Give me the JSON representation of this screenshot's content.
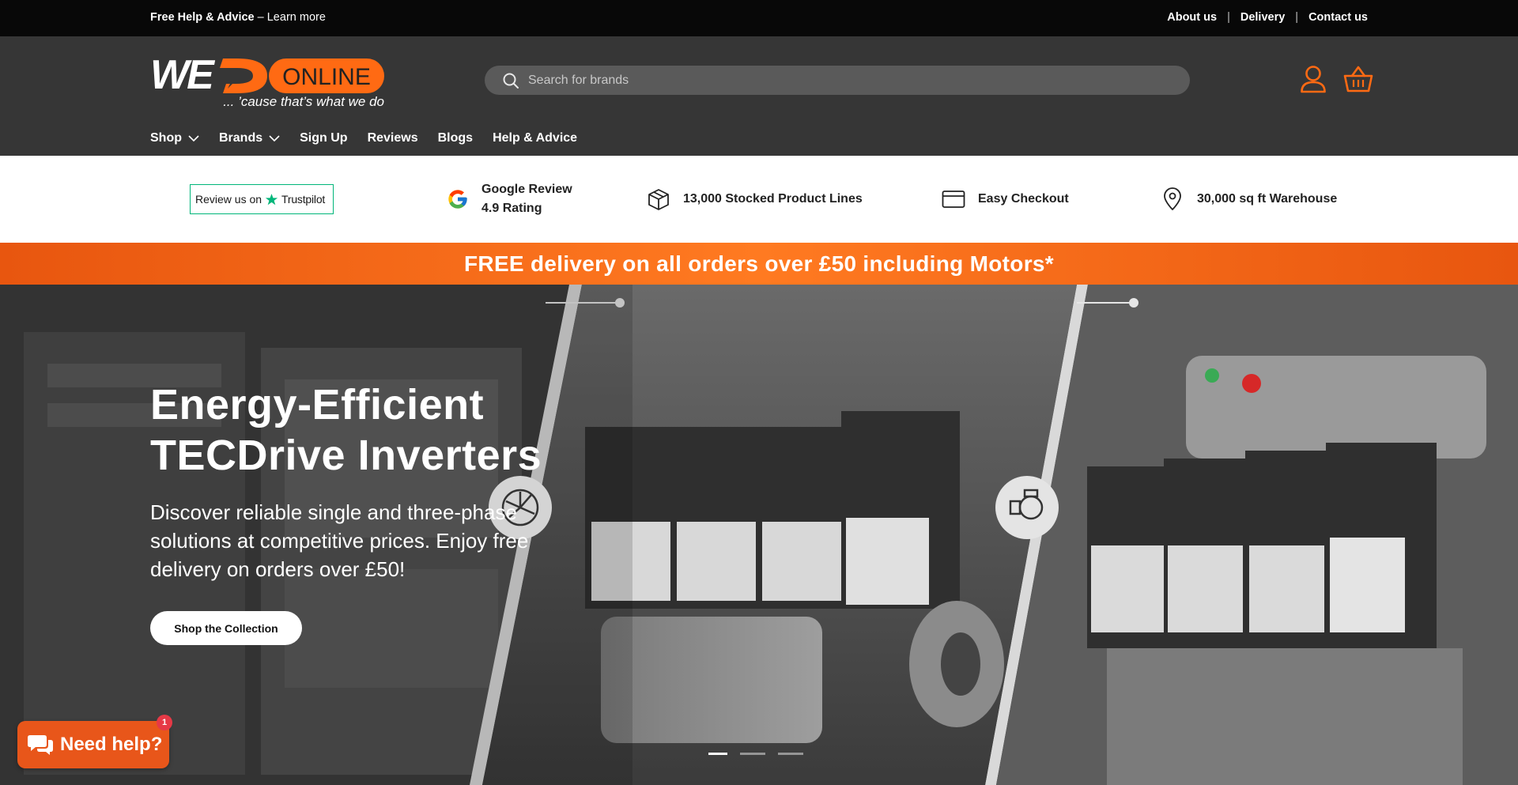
{
  "topbar": {
    "help_bold": "Free Help & Advice",
    "help_rest": " – Learn more",
    "links": [
      "About us",
      "Delivery",
      "Contact us"
    ]
  },
  "header": {
    "logo_text_left": "WE",
    "logo_text_right": "ONLINE",
    "logo_tagline": "... ’cause that’s what we do",
    "search_placeholder": "Search for brands",
    "icons": [
      "search-icon",
      "account-icon",
      "basket-icon"
    ]
  },
  "nav": {
    "items": [
      {
        "label": "Shop",
        "dropdown": true
      },
      {
        "label": "Brands",
        "dropdown": true
      },
      {
        "label": "Sign Up",
        "dropdown": false
      },
      {
        "label": "Reviews",
        "dropdown": false
      },
      {
        "label": "Blogs",
        "dropdown": false
      },
      {
        "label": "Help & Advice",
        "dropdown": false
      }
    ]
  },
  "trust": {
    "trustpilot_prefix": "Review us on",
    "trustpilot_brand": "Trustpilot",
    "google_line1": "Google Review",
    "google_line2": "4.9 Rating",
    "stocked": "13,000 Stocked Product Lines",
    "checkout": "Easy Checkout",
    "warehouse": "30,000 sq ft Warehouse"
  },
  "promo": {
    "text": "FREE delivery on all orders over £50 including Motors*"
  },
  "hero": {
    "title_line1": "Energy-Efficient",
    "title_line2": "TECDrive Inverters",
    "subtitle": "Discover reliable single and three-phase solutions at competitive prices. Enjoy free delivery on orders over £50!",
    "button_label": "Shop the Collection",
    "slides_total": 3,
    "active_slide": 1
  },
  "chat": {
    "label": "Need help?",
    "badge_count": "1"
  },
  "colors": {
    "accent_orange": "#F26A1B",
    "header_bg": "#363636",
    "topbar_bg": "#080808"
  }
}
